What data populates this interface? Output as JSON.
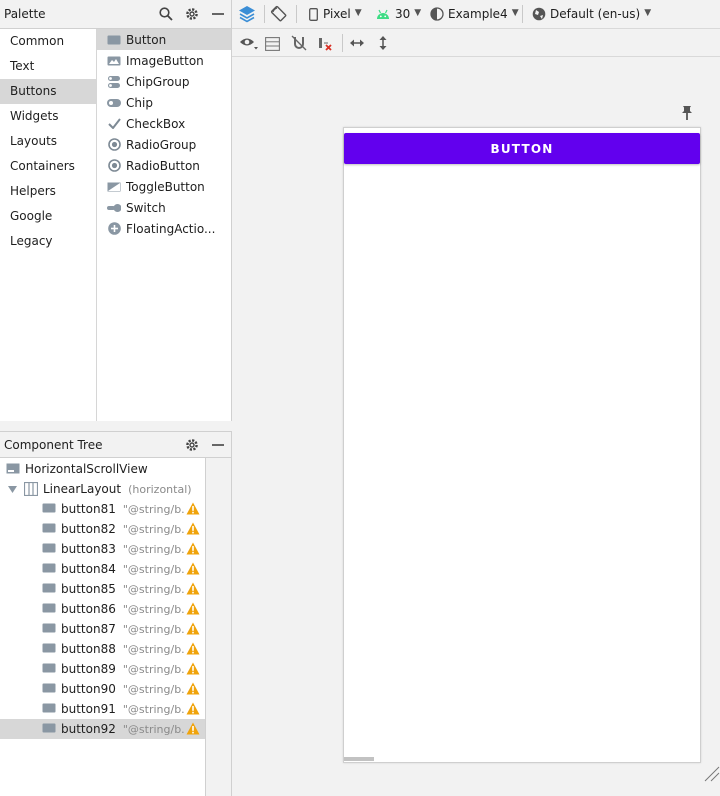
{
  "palette": {
    "title": "Palette",
    "categories": [
      "Common",
      "Text",
      "Buttons",
      "Widgets",
      "Layouts",
      "Containers",
      "Helpers",
      "Google",
      "Legacy"
    ],
    "selected_category": "Buttons",
    "items": [
      "Button",
      "ImageButton",
      "ChipGroup",
      "Chip",
      "CheckBox",
      "RadioGroup",
      "RadioButton",
      "ToggleButton",
      "Switch",
      "FloatingActio..."
    ],
    "selected_item": "Button",
    "icons": [
      "search-icon",
      "gear-icon",
      "minimize-icon"
    ]
  },
  "toolbar": {
    "device": "Pixel",
    "api": "30",
    "theme": "Example4",
    "locale": "Default (en-us)",
    "accent": "#3b8ed6",
    "android_green": "#3ddc84"
  },
  "component_tree": {
    "title": "Component Tree",
    "root": "HorizontalScrollView",
    "layout": {
      "name": "LinearLayout",
      "meta": "(horizontal)"
    },
    "buttons": [
      {
        "name": "button81",
        "meta": "\"@string/b..."
      },
      {
        "name": "button82",
        "meta": "\"@string/b..."
      },
      {
        "name": "button83",
        "meta": "\"@string/b..."
      },
      {
        "name": "button84",
        "meta": "\"@string/b..."
      },
      {
        "name": "button85",
        "meta": "\"@string/b..."
      },
      {
        "name": "button86",
        "meta": "\"@string/b..."
      },
      {
        "name": "button87",
        "meta": "\"@string/b..."
      },
      {
        "name": "button88",
        "meta": "\"@string/b..."
      },
      {
        "name": "button89",
        "meta": "\"@string/b..."
      },
      {
        "name": "button90",
        "meta": "\"@string/b..."
      },
      {
        "name": "button91",
        "meta": "\"@string/b..."
      },
      {
        "name": "button92",
        "meta": "\"@string/b..."
      }
    ],
    "selected": "button92",
    "warning_color": "#f0a30a"
  },
  "preview": {
    "button_label": "BUTTON",
    "button_color": "#6200ee"
  }
}
